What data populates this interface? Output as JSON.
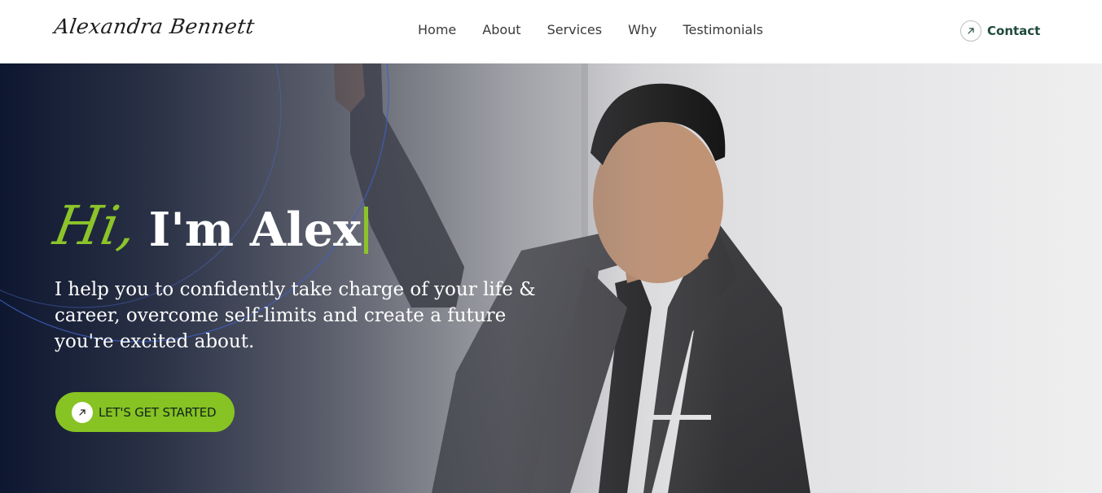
{
  "brand": {
    "logo_text": "Alexandra Bennett"
  },
  "nav": {
    "items": [
      {
        "label": "Home"
      },
      {
        "label": "About"
      },
      {
        "label": "Services"
      },
      {
        "label": "Why"
      },
      {
        "label": "Testimonials"
      }
    ],
    "contact_label": "Contact",
    "contact_icon": "arrow-up-right-icon"
  },
  "hero": {
    "greeting": "Hi,",
    "name": "I'm Alex",
    "tagline": "I help you to confidently take charge of your life & career, overcome self-limits and create a future you're excited about.",
    "cta_label": "LET'S GET STARTED",
    "cta_icon": "arrow-up-right-icon",
    "photo": "portrait of a man in a grey suit and black tie leaning on a wall"
  },
  "colors": {
    "accent_green": "#86c323",
    "contact_green": "#1e4b3a",
    "hero_dark": "#0e1730"
  }
}
